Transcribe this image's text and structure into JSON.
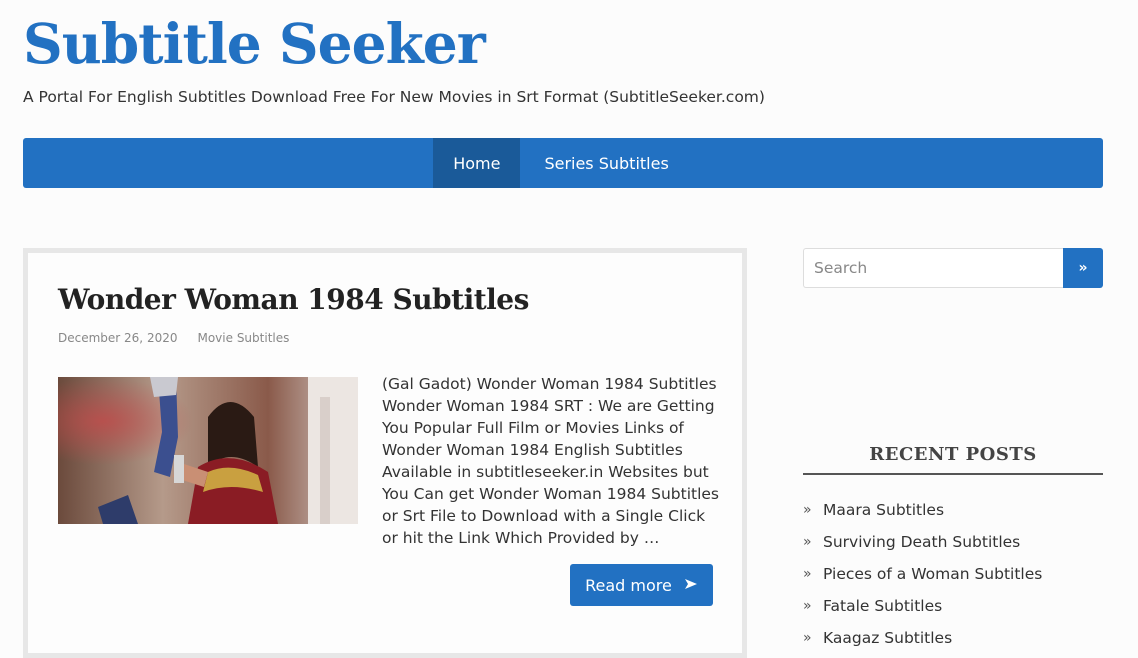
{
  "site": {
    "title": "Subtitle Seeker",
    "tagline": "A Portal For English Subtitles Download Free For New Movies in Srt Format (SubtitleSeeker.com)"
  },
  "nav": {
    "items": [
      {
        "label": "Home",
        "active": true
      },
      {
        "label": "Series Subtitles",
        "active": false
      }
    ]
  },
  "post": {
    "title": "Wonder Woman 1984 Subtitles",
    "date": "December 26, 2020",
    "category": "Movie Subtitles",
    "excerpt": "(Gal Gadot) Wonder Woman 1984 Subtitles Wonder Woman 1984 SRT : We are Getting You Popular Full Film or Movies Links of Wonder Woman 1984 English Subtitles Available in subtitleseeker.in Websites but You Can get Wonder Woman 1984 Subtitles or Srt File to Download with a Single Click or hit the Link Which Provided by …",
    "read_more": "Read more",
    "read_more_icon": "arrow-right-icon"
  },
  "sidebar": {
    "search": {
      "placeholder": "Search",
      "button": "»"
    },
    "recent_title": "RECENT POSTS",
    "bullet": "»",
    "recent_posts": [
      "Maara Subtitles",
      "Surviving Death Subtitles",
      "Pieces of a Woman Subtitles",
      "Fatale Subtitles",
      "Kaagaz Subtitles"
    ]
  },
  "colors": {
    "accent": "#2271c2",
    "accent_dark": "#1a5a99",
    "background": "#fcfcfc"
  }
}
